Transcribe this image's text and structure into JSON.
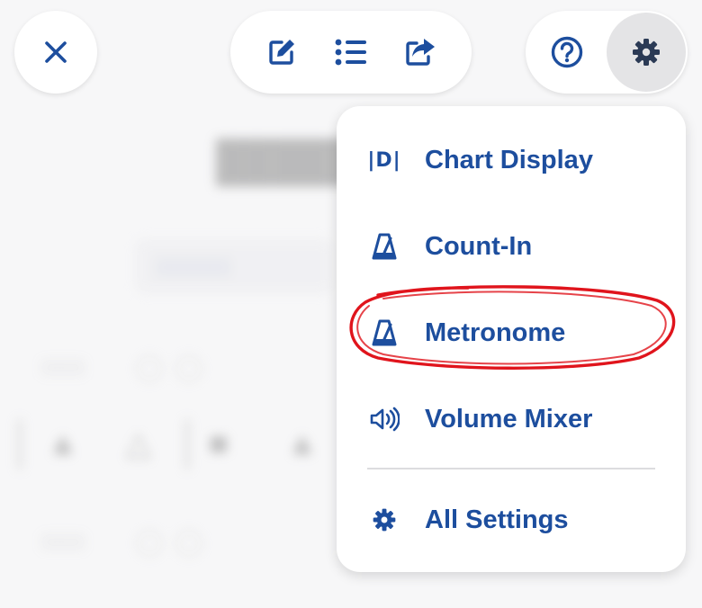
{
  "colors": {
    "accent": "#1d4e9e",
    "highlight_stroke": "#e0141c",
    "surface": "#ffffff",
    "background": "#f7f7f8"
  },
  "toolbar": {
    "close_icon": "close-icon",
    "edit_icon": "edit-icon",
    "list_icon": "list-icon",
    "share_icon": "share-icon",
    "help_icon": "help-icon",
    "settings_icon": "gear-icon"
  },
  "settings_menu": {
    "items": [
      {
        "label": "Chart Display",
        "icon": "chart-display-icon"
      },
      {
        "label": "Count-In",
        "icon": "metronome-icon"
      },
      {
        "label": "Metronome",
        "icon": "metronome-icon",
        "highlighted": true
      },
      {
        "label": "Volume Mixer",
        "icon": "speaker-icon"
      },
      {
        "label": "All Settings",
        "icon": "gear-icon"
      }
    ],
    "chart_display_glyph": "|D|"
  }
}
